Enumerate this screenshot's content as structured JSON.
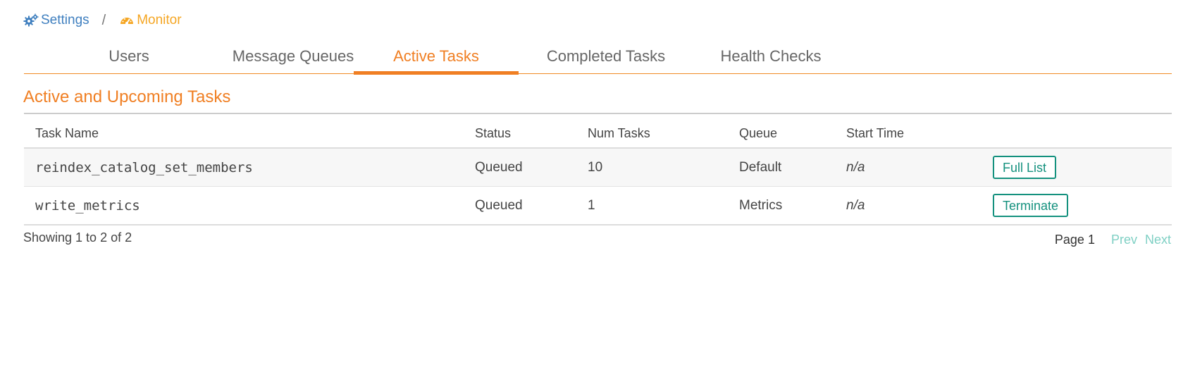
{
  "breadcrumb": {
    "items": [
      {
        "label": "Settings",
        "icon": "gears-icon",
        "color": "#3f7fbf"
      },
      {
        "label": "Monitor",
        "icon": "dashboard-icon",
        "color": "#f5a623"
      }
    ],
    "separator": "/"
  },
  "tabs": [
    {
      "label": "Users",
      "active": false
    },
    {
      "label": "Message Queues",
      "active": false
    },
    {
      "label": "Active Tasks",
      "active": true
    },
    {
      "label": "Completed Tasks",
      "active": false
    },
    {
      "label": "Health Checks",
      "active": false
    }
  ],
  "section": {
    "title": "Active and Upcoming Tasks"
  },
  "table": {
    "columns": [
      "Task Name",
      "Status",
      "Num Tasks",
      "Queue",
      "Start Time",
      ""
    ],
    "rows": [
      {
        "name": "reindex_catalog_set_members",
        "status": "Queued",
        "num_tasks": "10",
        "queue": "Default",
        "start_time": "n/a",
        "action": "Full List"
      },
      {
        "name": "write_metrics",
        "status": "Queued",
        "num_tasks": "1",
        "queue": "Metrics",
        "start_time": "n/a",
        "action": "Terminate"
      }
    ]
  },
  "footer": {
    "showing": "Showing 1 to 2 of 2",
    "page_label": "Page 1",
    "prev_label": "Prev",
    "next_label": "Next"
  },
  "colors": {
    "accent": "#f07f23",
    "link": "#3f7fbf",
    "button": "#14917e",
    "pager_disabled": "#7fd0c4"
  }
}
